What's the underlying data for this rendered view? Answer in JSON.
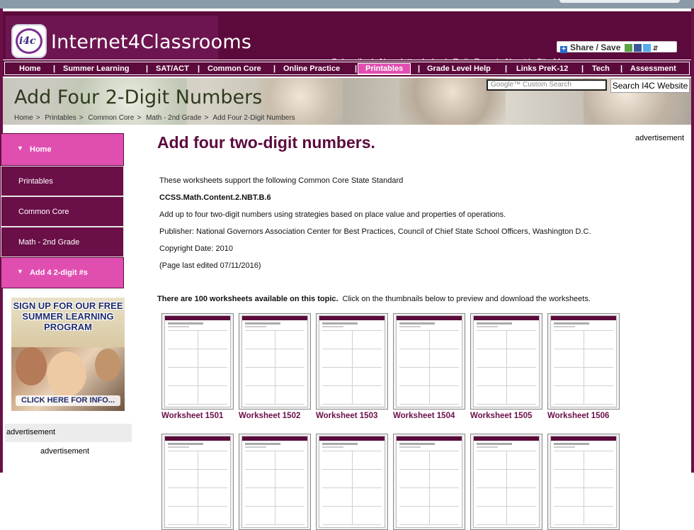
{
  "site": {
    "name": "Internet4Classrooms",
    "logo_text": "i4c"
  },
  "top_links": [
    "Subscribe",
    "Newsletter Index",
    "Daily Dose",
    "About",
    "Site Map"
  ],
  "share_label": "Share / Save",
  "nav": {
    "items": [
      "Home",
      "Summer Learning",
      "SAT/ACT",
      "Common Core",
      "Online Practice",
      "Printables",
      "Grade Level Help",
      "Links PreK-12",
      "Tech",
      "Assessment"
    ],
    "active": "Printables"
  },
  "banner": {
    "title": "Add Four 2-Digit Numbers",
    "breadcrumb": [
      "Home",
      "Printables",
      "Common Core",
      "Math - 2nd Grade",
      "Add Four 2-Digit Numbers"
    ],
    "search_placeholder": "Google™ Custom Search",
    "search_button": "Search I4C Website"
  },
  "sidebar": {
    "items": [
      "Home",
      "Printables",
      "Common Core",
      "Math - 2nd Grade",
      "Add 4 2-digit #s"
    ],
    "promo_text": "SIGN UP FOR OUR FREE SUMMER LEARNING PROGRAM",
    "promo_cta": "CLICK HERE FOR INFO...",
    "advertisement_label": "advertisement",
    "advertisement_label_2": "advertisement"
  },
  "right_ad_label": "advertisement",
  "main": {
    "heading": "Add four two-digit numbers.",
    "intro": "These worksheets support the following Common Core State Standard",
    "standard_code": "CCSS.Math.Content.2.NBT.B.6",
    "standard_text": "Add up to four two-digit numbers using strategies based on place value and properties of operations.",
    "publisher": "Publisher: National Governors Association Center for Best Practices, Council of Chief State School Officers, Washington D.C.",
    "copyright": "Copyright Date: 2010",
    "last_edited": "(Page last edited 07/11/2016)",
    "count_bold": "There are 100 worksheets available on this topic.",
    "count_rest": "Click on the thumbnails below to preview and download the worksheets."
  },
  "worksheets": [
    "Worksheet 1501",
    "Worksheet 1502",
    "Worksheet 1503",
    "Worksheet 1504",
    "Worksheet 1505",
    "Worksheet 1506"
  ],
  "colors": {
    "brand": "#5c0a3c",
    "accent_pink": "#e04fb0",
    "sidebar_dark": "#6b0f48"
  }
}
